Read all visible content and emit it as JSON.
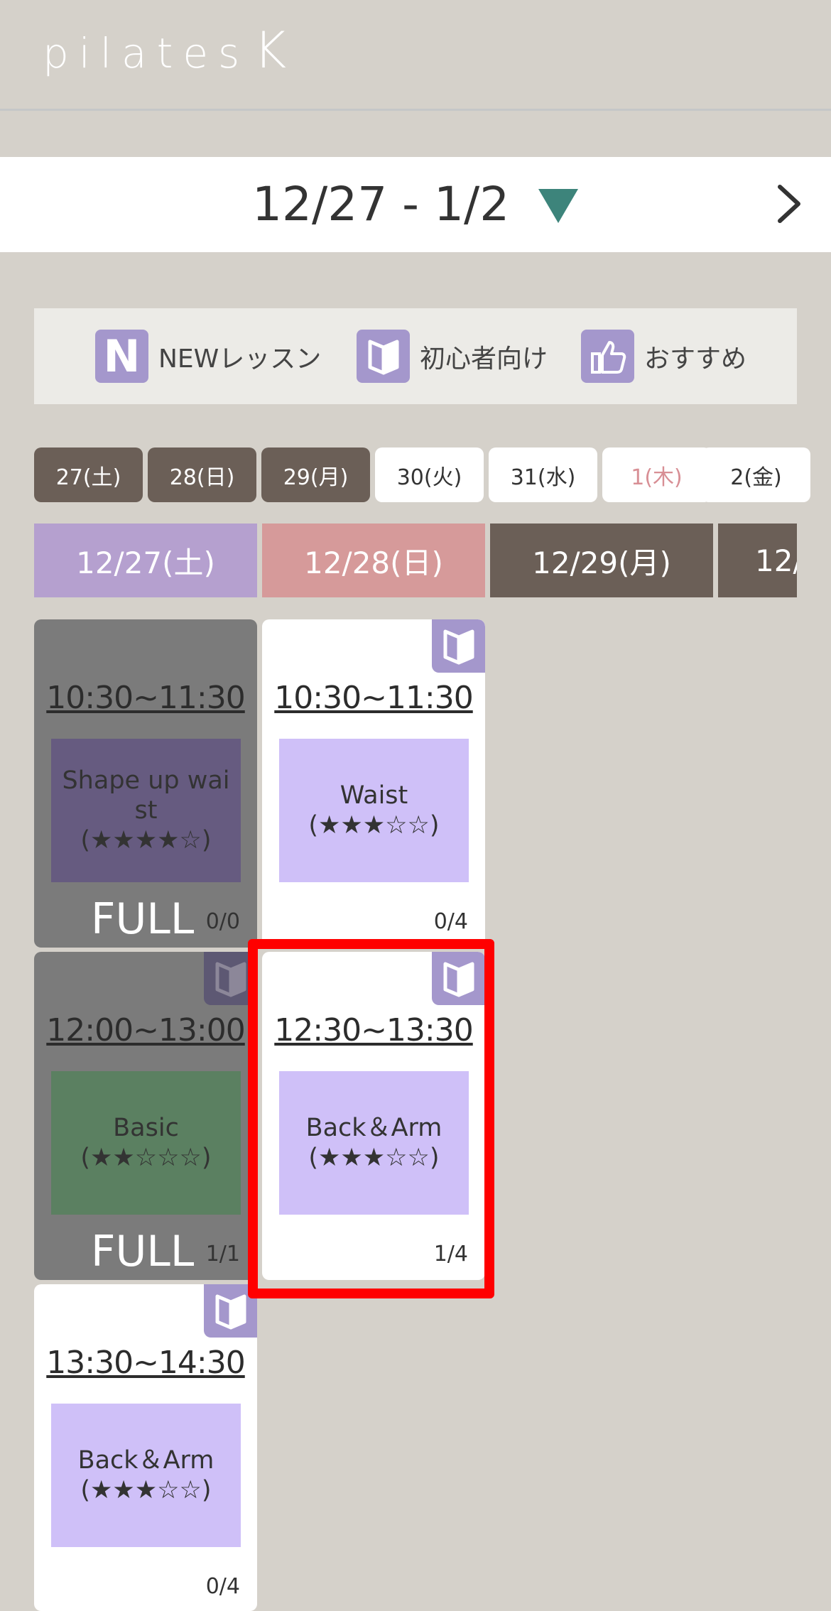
{
  "app": {
    "logo_text": "pilates",
    "logo_k": "K"
  },
  "week": {
    "range": "12/27 - 1/2",
    "dropdown_icon": "triangle-down-icon",
    "next_icon": "chevron-right-icon"
  },
  "legend": {
    "items": [
      {
        "icon": "new-icon",
        "icon_text": "N",
        "label": "NEWレッスン"
      },
      {
        "icon": "beginner-icon",
        "label": "初心者向け"
      },
      {
        "icon": "thumbs-up-icon",
        "label": "おすすめ"
      }
    ]
  },
  "day_tabs": [
    {
      "label": "27(土)",
      "state": "past"
    },
    {
      "label": "28(日)",
      "state": "past"
    },
    {
      "label": "29(月)",
      "state": "past"
    },
    {
      "label": "30(火)",
      "state": "future"
    },
    {
      "label": "31(水)",
      "state": "future"
    },
    {
      "label": "1(木)",
      "state": "holiday"
    },
    {
      "label": "2(金)",
      "state": "future"
    }
  ],
  "columns": [
    {
      "label": "12/27(土)",
      "color": "#b5a0cf"
    },
    {
      "label": "12/28(日)",
      "color": "#d69a9a"
    },
    {
      "label": "12/29(月)",
      "color": "#6b5f57"
    },
    {
      "label": "12/",
      "color": "#6b5f57"
    }
  ],
  "cards": {
    "c1": {
      "time": "10:30~11:30",
      "lesson_line1": "Shape up waist",
      "lesson_line2": "(★★★★☆)",
      "lesson_color": "#665b80",
      "status": "FULL",
      "capacity": "0/0"
    },
    "c2": {
      "time": "10:30~11:30",
      "lesson_line1": "Waist",
      "lesson_line2": "(★★★☆☆)",
      "lesson_color": "#cfc0f8",
      "capacity": "0/4"
    },
    "c3": {
      "time": "12:00~13:00",
      "lesson_line1": "Basic",
      "lesson_line2": "(★★☆☆☆)",
      "lesson_color": "#5b8061",
      "status": "FULL",
      "capacity": "1/1"
    },
    "c4": {
      "time": "12:30~13:30",
      "lesson_line1": "Back＆Arm",
      "lesson_line2": "(★★★☆☆)",
      "lesson_color": "#cfc0f8",
      "capacity": "1/4"
    },
    "c5": {
      "time": "13:30~14:30",
      "lesson_line1": "Back＆Arm",
      "lesson_line2": "(★★★☆☆)",
      "lesson_color": "#cfc0f8",
      "capacity": "0/4"
    }
  }
}
